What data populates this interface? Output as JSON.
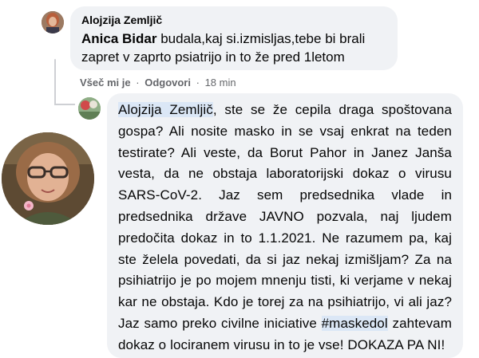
{
  "comment": {
    "author": "Alojzija Zemljič",
    "mention": "Anica Bidar",
    "text": " budala,kaj si.izmisljas,tebe bi brali zapret v zaprto psiatrijo in to že pred 1letom"
  },
  "actions": {
    "like": "Všeč mi je",
    "separator": "·",
    "reply": "Odgovori",
    "time": "18 min"
  },
  "reply": {
    "mention": "Alojzija Zemljič",
    "text_before_hashtag": ", ste se že cepila draga spoštovana gospa? Ali nosite masko in se vsaj enkrat na teden testirate? Ali veste, da Borut Pahor in Janez Janša vesta, da ne obstaja laboratorijski dokaz o virusu SARS-CoV-2. Jaz sem predsednika vlade in predsednika države JAVNO pozvala, naj ljudem predočita dokaz in to 1.1.2021. Ne razumem pa, kaj ste želela povedati, da si jaz nekaj izmišljam? Za na psihiatrijo je po mojem mnenju tisti, ki verjame v nekaj kar ne obstaja. Kdo je torej za na psihiatrijo, vi ali jaz? Jaz samo preko civilne iniciative ",
    "hashtag": "#maskedol",
    "text_after_hashtag": " zahtevam dokaz o lociranem virusu in to je vse! DOKAZA PA NI!"
  }
}
